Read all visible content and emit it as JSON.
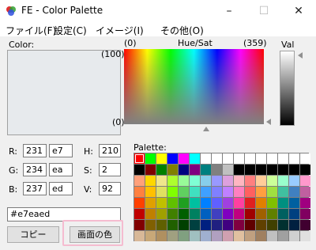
{
  "window": {
    "title": "FE - Color Palette",
    "minimize_glyph": "–",
    "maximize_glyph": "☐",
    "close_glyph": "✕"
  },
  "menu": [
    "ファイル(F)",
    "設定(C)",
    "イメージ(I)",
    "その他(O)"
  ],
  "color": {
    "label": "Color:",
    "current_hex": "#e7eaed",
    "r_label": "R:",
    "r": "231",
    "r_hex": "e7",
    "g_label": "G:",
    "g": "234",
    "g_hex": "ea",
    "b_label": "B:",
    "b": "237",
    "b_hex": "ed",
    "h_label": "H:",
    "h": "210",
    "s_label": "S:",
    "s": "2",
    "v_label": "V:",
    "v": "92"
  },
  "hue_sat": {
    "label": "Hue/Sat",
    "hue_min": "(0)",
    "hue_max": "(359)",
    "sat_max": "(100)",
    "sat_min": "(0)"
  },
  "val": {
    "label": "Val"
  },
  "palette": {
    "label": "Palette:",
    "colors": [
      "#ff0000",
      "#00ff00",
      "#ffff00",
      "#0000ff",
      "#ff00ff",
      "#00ffff",
      "#ffffff",
      "#ffffff",
      "#ffffff",
      "#ffffff",
      "#ffffff",
      "#ffffff",
      "#ffffff",
      "#ffffff",
      "#ffffff",
      "#ffffff",
      "#000000",
      "#800000",
      "#008000",
      "#808000",
      "#000080",
      "#800080",
      "#008080",
      "#808080",
      "#c0c0c0",
      "#000000",
      "#000000",
      "#000000",
      "#000000",
      "#000000",
      "#000000",
      "#000000",
      "#ffa07a",
      "#ffd700",
      "#f0e68c",
      "#adff2f",
      "#98fb98",
      "#7fffd4",
      "#87ceeb",
      "#9999ff",
      "#dda0dd",
      "#ffb6c1",
      "#ff7f7f",
      "#ffcc99",
      "#ccff99",
      "#99ffcc",
      "#99ccff",
      "#ff99cc",
      "#ff8040",
      "#ffc000",
      "#e0e060",
      "#80ff00",
      "#60d060",
      "#40e0c0",
      "#40a0ff",
      "#8080ff",
      "#c080ff",
      "#ff80c0",
      "#ff6060",
      "#ff9f40",
      "#a0e040",
      "#40c0a0",
      "#4080c0",
      "#c060a0",
      "#ff4000",
      "#e0a000",
      "#c0c000",
      "#60c000",
      "#20a020",
      "#00c0a0",
      "#0080ff",
      "#6060ff",
      "#a040e0",
      "#ff40a0",
      "#e02020",
      "#e08000",
      "#80c000",
      "#009080",
      "#0060a0",
      "#a00080",
      "#c00000",
      "#c08000",
      "#a0a000",
      "#408000",
      "#006000",
      "#008060",
      "#0060c0",
      "#4040c0",
      "#8000c0",
      "#c00080",
      "#a00000",
      "#a06000",
      "#608000",
      "#006060",
      "#004080",
      "#800060",
      "#800000",
      "#806000",
      "#606000",
      "#206000",
      "#004000",
      "#004040",
      "#002080",
      "#202080",
      "#400080",
      "#800040",
      "#600000",
      "#604000",
      "#404000",
      "#003030",
      "#002040",
      "#400030",
      "#d8b898",
      "#c8a878",
      "#b09060",
      "#a0a080",
      "#80a080",
      "#a0c0c0",
      "#a0b0d0",
      "#b0a0c0",
      "#d0a0b0",
      "#e0c0a0",
      "#c0a080",
      "#a08060",
      "#c0c0c0",
      "#a0a0a0",
      "#d0d0d0",
      "#e0e0e0"
    ]
  },
  "buttons": {
    "copy": "コピー",
    "screen_color": "画面の色"
  }
}
